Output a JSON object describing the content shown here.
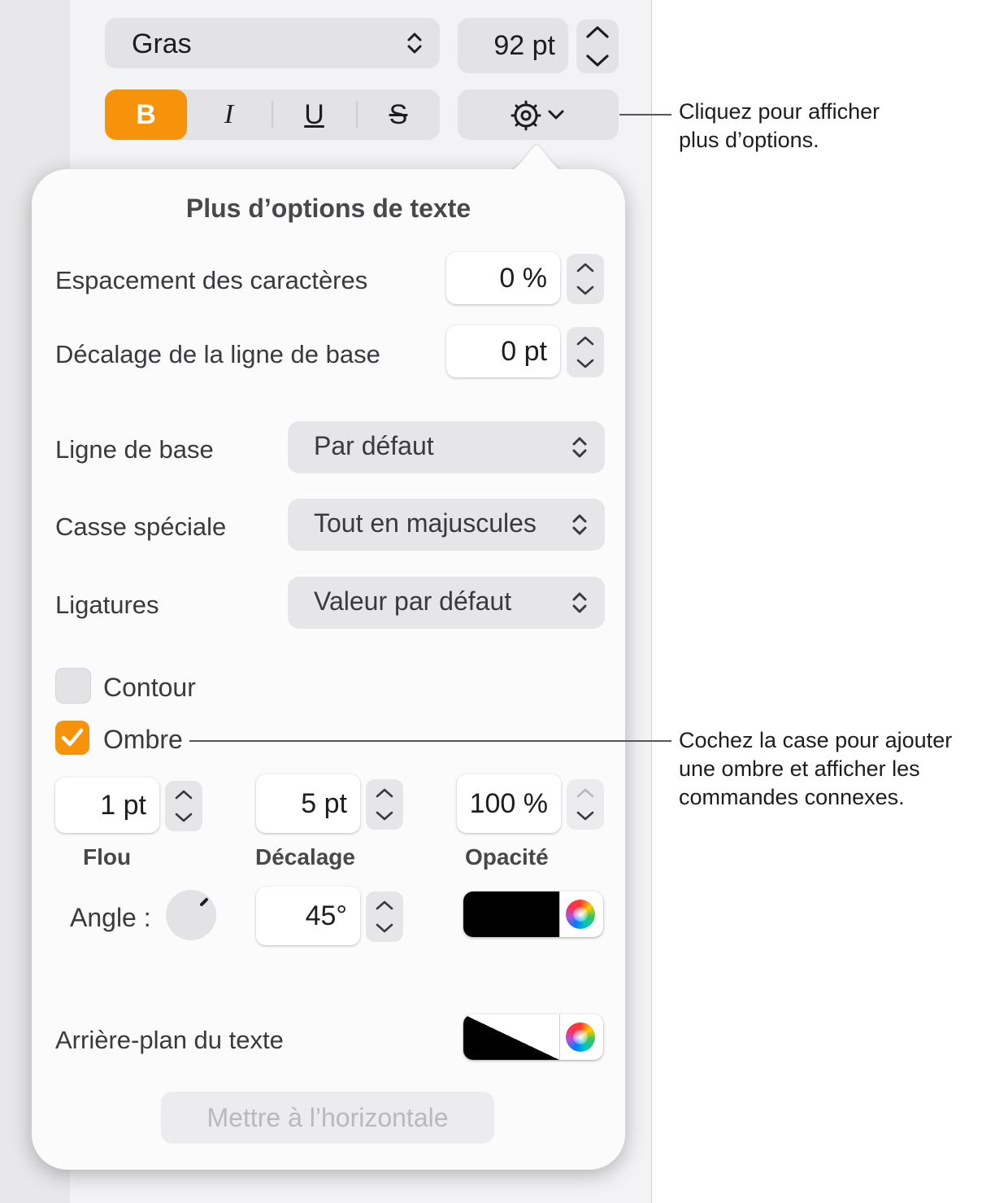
{
  "toolbar": {
    "font_style": "Gras",
    "font_size": "92 pt",
    "bold_label": "B",
    "italic_label": "I",
    "underline_label": "U",
    "strike_label": "S",
    "accent_color": "#f7930a",
    "options_icon": "gear-icon"
  },
  "popover": {
    "title": "Plus d’options de texte",
    "char_spacing": {
      "label": "Espacement des caractères",
      "value": "0 %"
    },
    "baseline_shift": {
      "label": "Décalage de la ligne de base",
      "value": "0 pt"
    },
    "baseline": {
      "label": "Ligne de base",
      "value": "Par défaut"
    },
    "special_case": {
      "label": "Casse spéciale",
      "value": "Tout en majuscules"
    },
    "ligatures": {
      "label": "Ligatures",
      "value": "Valeur par défaut"
    },
    "outline": {
      "label": "Contour",
      "checked": false
    },
    "shadow": {
      "label": "Ombre",
      "checked": true,
      "blur": {
        "value": "1 pt",
        "label": "Flou"
      },
      "offset": {
        "value": "5 pt",
        "label": "Décalage"
      },
      "opacity": {
        "value": "100 %",
        "label": "Opacité"
      },
      "angle": {
        "label": "Angle :",
        "value": "45°"
      },
      "color": "#000000"
    },
    "text_background": {
      "label": "Arrière-plan du texte"
    },
    "straighten_button": "Mettre à l’horizontale"
  },
  "callouts": {
    "options": "Cliquez pour afficher\nplus d’options.",
    "shadow": "Cochez la case pour ajouter\nune ombre et afficher les\ncommandes connexes."
  }
}
